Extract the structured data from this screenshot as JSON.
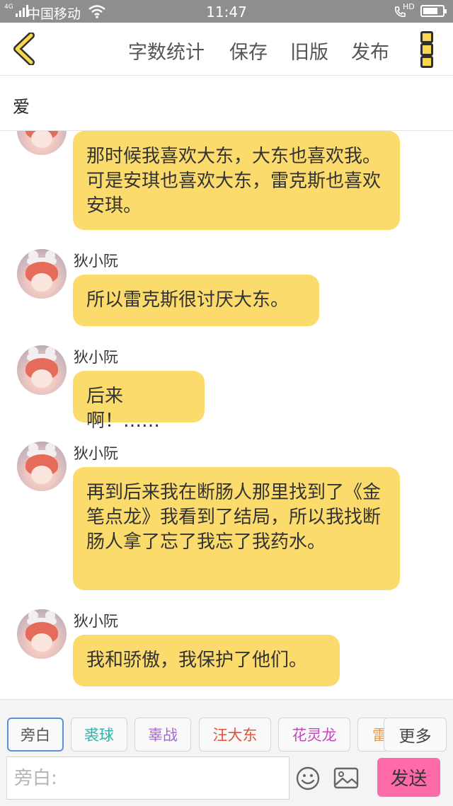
{
  "status_bar": {
    "network": "4G",
    "carrier": "中国移动",
    "time": "11:47",
    "call_badge": "HD",
    "battery_level": 0.75
  },
  "toolbar": {
    "actions": [
      "字数统计",
      "保存",
      "旧版",
      "发布"
    ]
  },
  "document": {
    "title": "爱"
  },
  "messages": [
    {
      "sender": "",
      "text": "那时候我喜欢大东，大东也喜欢我。可是安琪也喜欢大东，雷克斯也喜欢安琪。"
    },
    {
      "sender": "狄小阮",
      "text": "所以雷克斯很讨厌大东。"
    },
    {
      "sender": "狄小阮",
      "text": "后来啊！……"
    },
    {
      "sender": "狄小阮",
      "text": "再到后来我在断肠人那里找到了《金笔点龙》我看到了结局，所以我找断肠人拿了忘了我忘了我药水。"
    },
    {
      "sender": "狄小阮",
      "text": "我和骄傲，我保护了他们。"
    }
  ],
  "roles": [
    {
      "label": "旁白",
      "color": "#555555"
    },
    {
      "label": "裘球",
      "color": "#2bb5a8"
    },
    {
      "label": "辜战",
      "color": "#a46ad0"
    },
    {
      "label": "汪大东",
      "color": "#e0533c"
    },
    {
      "label": "花灵龙",
      "color": "#c14ab8"
    },
    {
      "label": "雷",
      "color": "#e89a4a"
    }
  ],
  "more_roles_label": "更多",
  "composer": {
    "placeholder": "旁白:",
    "send_label": "发送"
  },
  "colors": {
    "bubble": "#fcdb6d",
    "send_button": "#ff6ba8",
    "back_icon": "#f7d84e"
  }
}
